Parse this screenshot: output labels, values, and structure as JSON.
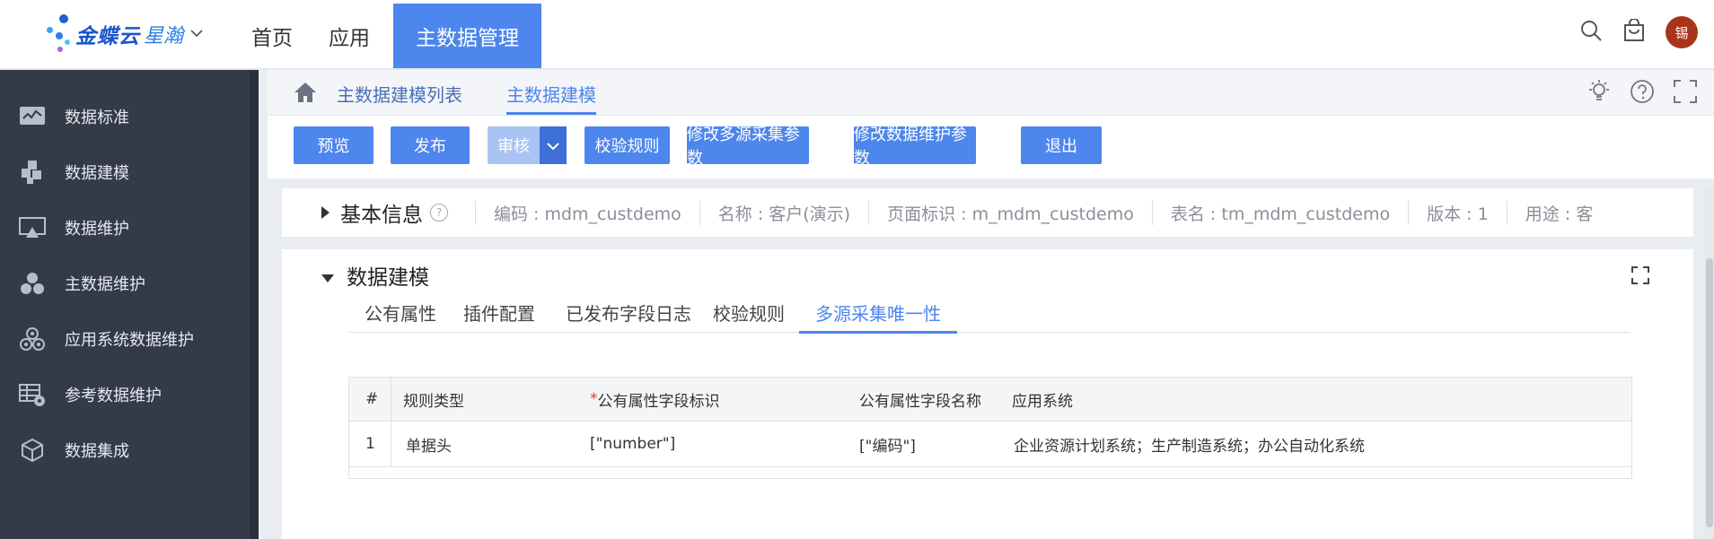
{
  "brand": {
    "name": "金蝶云",
    "product": "星瀚"
  },
  "topnav": {
    "items": [
      "首页",
      "应用"
    ],
    "active": "主数据管理"
  },
  "user": {
    "avatar_text": "锡"
  },
  "sidebar": {
    "items": [
      {
        "label": "数据标准",
        "icon": "chart-monitor-icon"
      },
      {
        "label": "数据建模",
        "icon": "blocks-icon"
      },
      {
        "label": "数据维护",
        "icon": "screen-icon"
      },
      {
        "label": "主数据维护",
        "icon": "cluster-icon"
      },
      {
        "label": "应用系统数据维护",
        "icon": "app-cluster-icon"
      },
      {
        "label": "参考数据维护",
        "icon": "table-gear-icon"
      },
      {
        "label": "数据集成",
        "icon": "cube-icon"
      }
    ]
  },
  "breadcrumb": {
    "list": "主数据建模列表",
    "current": "主数据建模"
  },
  "toolbar": {
    "preview": "预览",
    "publish": "发布",
    "review": "审核",
    "validate_rules": "校验规则",
    "edit_multisource": "修改多源采集参数",
    "edit_maintain": "修改数据维护参数",
    "exit": "退出"
  },
  "basic_info": {
    "title": "基本信息",
    "help": "?",
    "fields": [
      "编码 : mdm_custdemo",
      "名称 : 客户(演示)",
      "页面标识 : m_mdm_custdemo",
      "表名 : tm_mdm_custdemo",
      "版本 : 1",
      "用途 : 客"
    ]
  },
  "modeling": {
    "title": "数据建模",
    "tabs": [
      "公有属性",
      "插件配置",
      "已发布字段日志",
      "校验规则",
      "多源采集唯一性"
    ],
    "active_tab": 4
  },
  "table": {
    "headers": {
      "num": "#",
      "rule_type": "规则类型",
      "required_mark": "*",
      "field_id": "公有属性字段标识",
      "field_name": "公有属性字段名称",
      "app_system": "应用系统"
    },
    "rows": [
      {
        "num": "1",
        "rule_type": "单据头",
        "field_id": "[\"number\"]",
        "field_name": "[\"编码\"]",
        "app_system": "企业资源计划系统；生产制造系统；办公自动化系统"
      }
    ]
  }
}
